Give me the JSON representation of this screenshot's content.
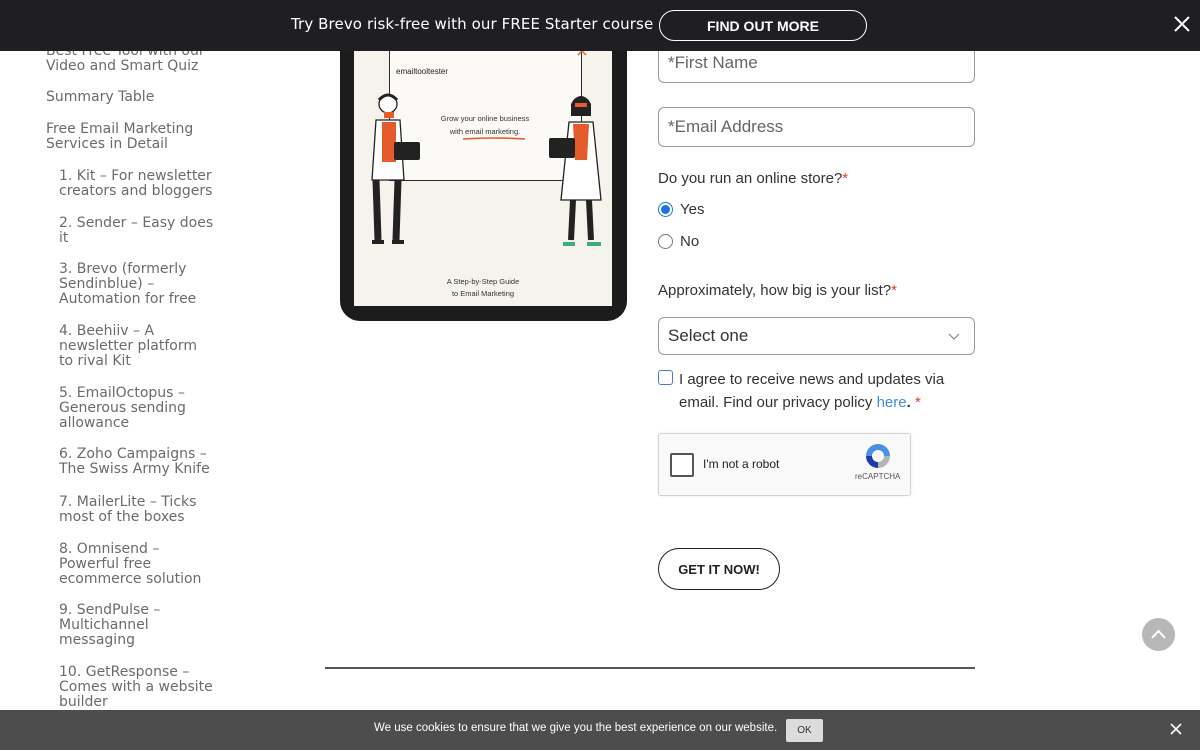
{
  "banner": {
    "text": "Try Brevo risk-free with our FREE Starter course",
    "button_label": "FIND OUT MORE",
    "close_icon": "close-icon"
  },
  "toc": {
    "items": [
      {
        "label": "Best Free Tool with our Video and Smart Quiz",
        "level": 1
      },
      {
        "label": "Summary Table",
        "level": 1
      },
      {
        "label": "Free Email Marketing Services in Detail",
        "level": 1
      },
      {
        "label": "1. Kit – For newsletter creators and bloggers",
        "level": 2
      },
      {
        "label": "2. Sender – Easy does it",
        "level": 2
      },
      {
        "label": "3. Brevo (formerly Sendinblue) – Automation for free",
        "level": 2
      },
      {
        "label": "4. Beehiiv – A newsletter platform to rival Kit",
        "level": 2
      },
      {
        "label": "5. EmailOctopus – Generous sending allowance",
        "level": 2
      },
      {
        "label": "6. Zoho Campaigns – The Swiss Army Knife",
        "level": 2
      },
      {
        "label": "7. MailerLite – Ticks most of the boxes",
        "level": 2
      },
      {
        "label": "8. Omnisend – Powerful free ecommerce solution",
        "level": 2
      },
      {
        "label": "9. SendPulse – Multichannel messaging",
        "level": 2
      },
      {
        "label": "10. GetResponse – Comes with a website builder",
        "level": 2
      }
    ]
  },
  "ebook": {
    "brand": "emailtooltester",
    "tagline_line1": "Grow your online business",
    "tagline_line2": "with email marketing.",
    "subtitle_line1": "A Step-by-Step Guide",
    "subtitle_line2": "to Email Marketing"
  },
  "form": {
    "first_name_placeholder": "*First Name",
    "email_placeholder": "*Email Address",
    "store_question": "Do you run an online store?",
    "required_mark": "*",
    "radio_options": [
      "Yes",
      "No"
    ],
    "radio_selected": "Yes",
    "list_question": "Approximately, how big is your list?",
    "list_select_value": "Select one",
    "consent_text": "I agree to receive news and updates via email. Find our privacy policy",
    "consent_link": "here",
    "consent_period": ".",
    "captcha_label": "I'm not a robot",
    "captcha_brand": "reCAPTCHA",
    "submit_label": "GET IT NOW!"
  },
  "cookie": {
    "text": "We use cookies to ensure that we give you the best experience on our website.",
    "ok_label": "OK"
  },
  "colors": {
    "banner_bg": "#1f1f23",
    "required_red": "#e0392b",
    "link_blue": "#3d8fd9",
    "radio_blue": "#1a73e8",
    "cookie_bg": "#4d4d4d"
  }
}
